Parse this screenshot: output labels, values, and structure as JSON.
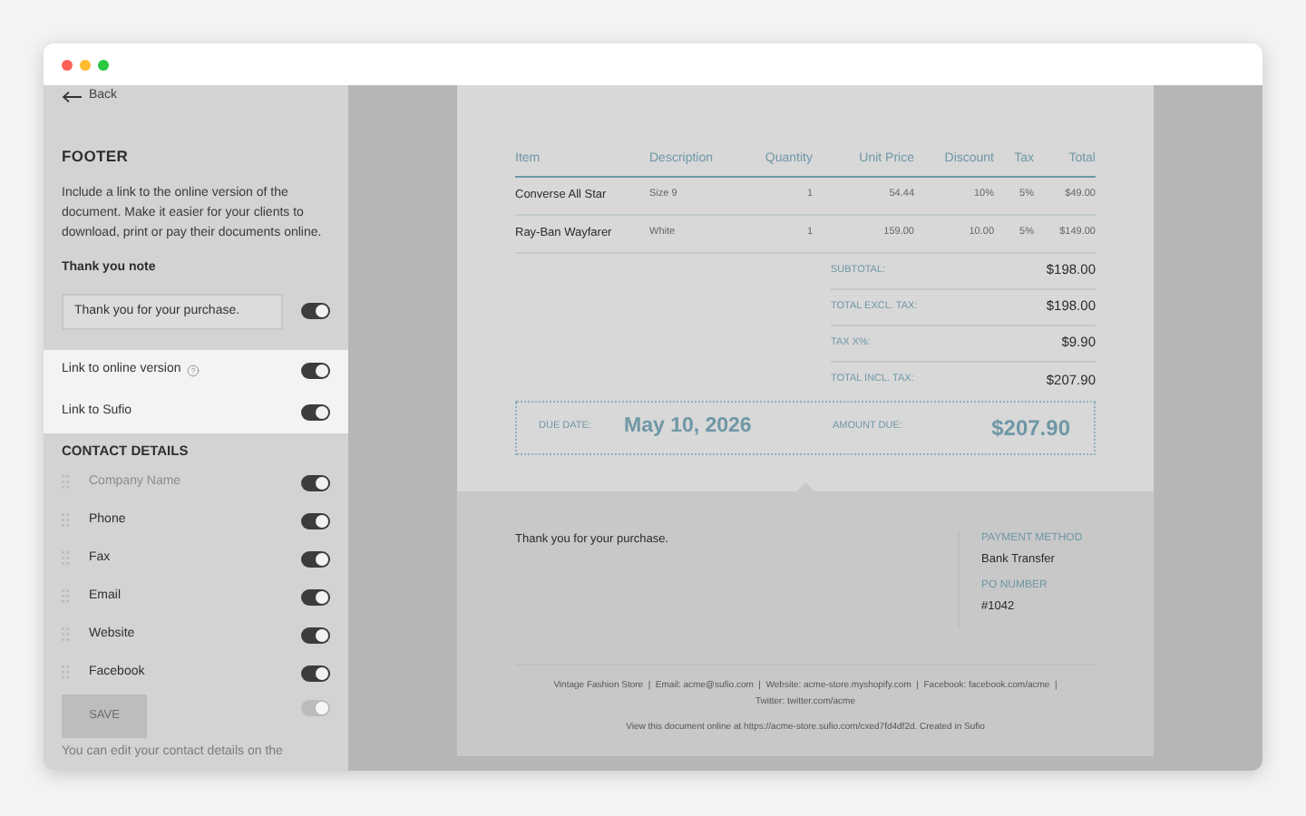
{
  "sidebar": {
    "back": "Back",
    "section_title": "FOOTER",
    "description": "Include a link to the online version of the document. Make it easier for your clients to download, print or pay their documents online.",
    "note_label": "Thank you note",
    "note": {
      "value": "Thank you for your purchase.",
      "on": true
    },
    "links": [
      {
        "label": "Link to online version",
        "help": true,
        "on": true
      },
      {
        "label": "Link to Sufio",
        "help": false,
        "on": true
      }
    ],
    "contact_title": "CONTACT DETAILS",
    "contacts": [
      {
        "label": "Company Name",
        "disabled": true,
        "on": true
      },
      {
        "label": "Phone",
        "disabled": false,
        "on": true
      },
      {
        "label": "Fax",
        "disabled": false,
        "on": true
      },
      {
        "label": "Email",
        "disabled": false,
        "on": true
      },
      {
        "label": "Website",
        "disabled": false,
        "on": true
      },
      {
        "label": "Facebook",
        "disabled": false,
        "on": true
      }
    ],
    "extra_toggle": {
      "on": true,
      "disabled": true
    },
    "save_button": {
      "label": "SAVE",
      "disabled": true
    },
    "hint": "You can edit your contact details on the"
  },
  "document": {
    "columns": [
      "Item",
      "Description",
      "Quantity",
      "Unit Price",
      "Discount",
      "Tax",
      "Total"
    ],
    "rows": [
      [
        "Converse All Star",
        "Size 9",
        "1",
        "54.44",
        "10%",
        "5%",
        "$49.00"
      ],
      [
        "Ray-Ban Wayfarer",
        "White",
        "1",
        "159.00",
        "10.00",
        "5%",
        "$149.00"
      ]
    ],
    "totals": [
      {
        "label": "SUBTOTAL:",
        "value": "$198.00"
      },
      {
        "label": "TOTAL EXCL. TAX:",
        "value": "$198.00"
      },
      {
        "label": "TAX X%:",
        "value": "$9.90"
      },
      {
        "label": "TOTAL INCL. TAX:",
        "value": "$207.90"
      }
    ],
    "due_date": {
      "label": "DUE DATE:",
      "value": "May 10, 2026"
    },
    "amount_due": {
      "label": "AMOUNT DUE:",
      "value": "$207.90"
    },
    "footer": {
      "note": "Thank you for your purchase.",
      "details": [
        {
          "label": "PAYMENT METHOD",
          "value": "Bank Transfer"
        },
        {
          "label": "PO NUMBER",
          "value": "#1042"
        }
      ],
      "contact_line": "Vintage Fashion Store  |  Email: acme@sufio.com  |  Website: acme-store.myshopify.com  |  Facebook: facebook.com/acme  |",
      "contact_line_2": "Twitter: twitter.com/acme",
      "online_line": "View this document online at https://acme-store.sufio.com/cxed7fd4df2d. Created in Sufio"
    }
  }
}
